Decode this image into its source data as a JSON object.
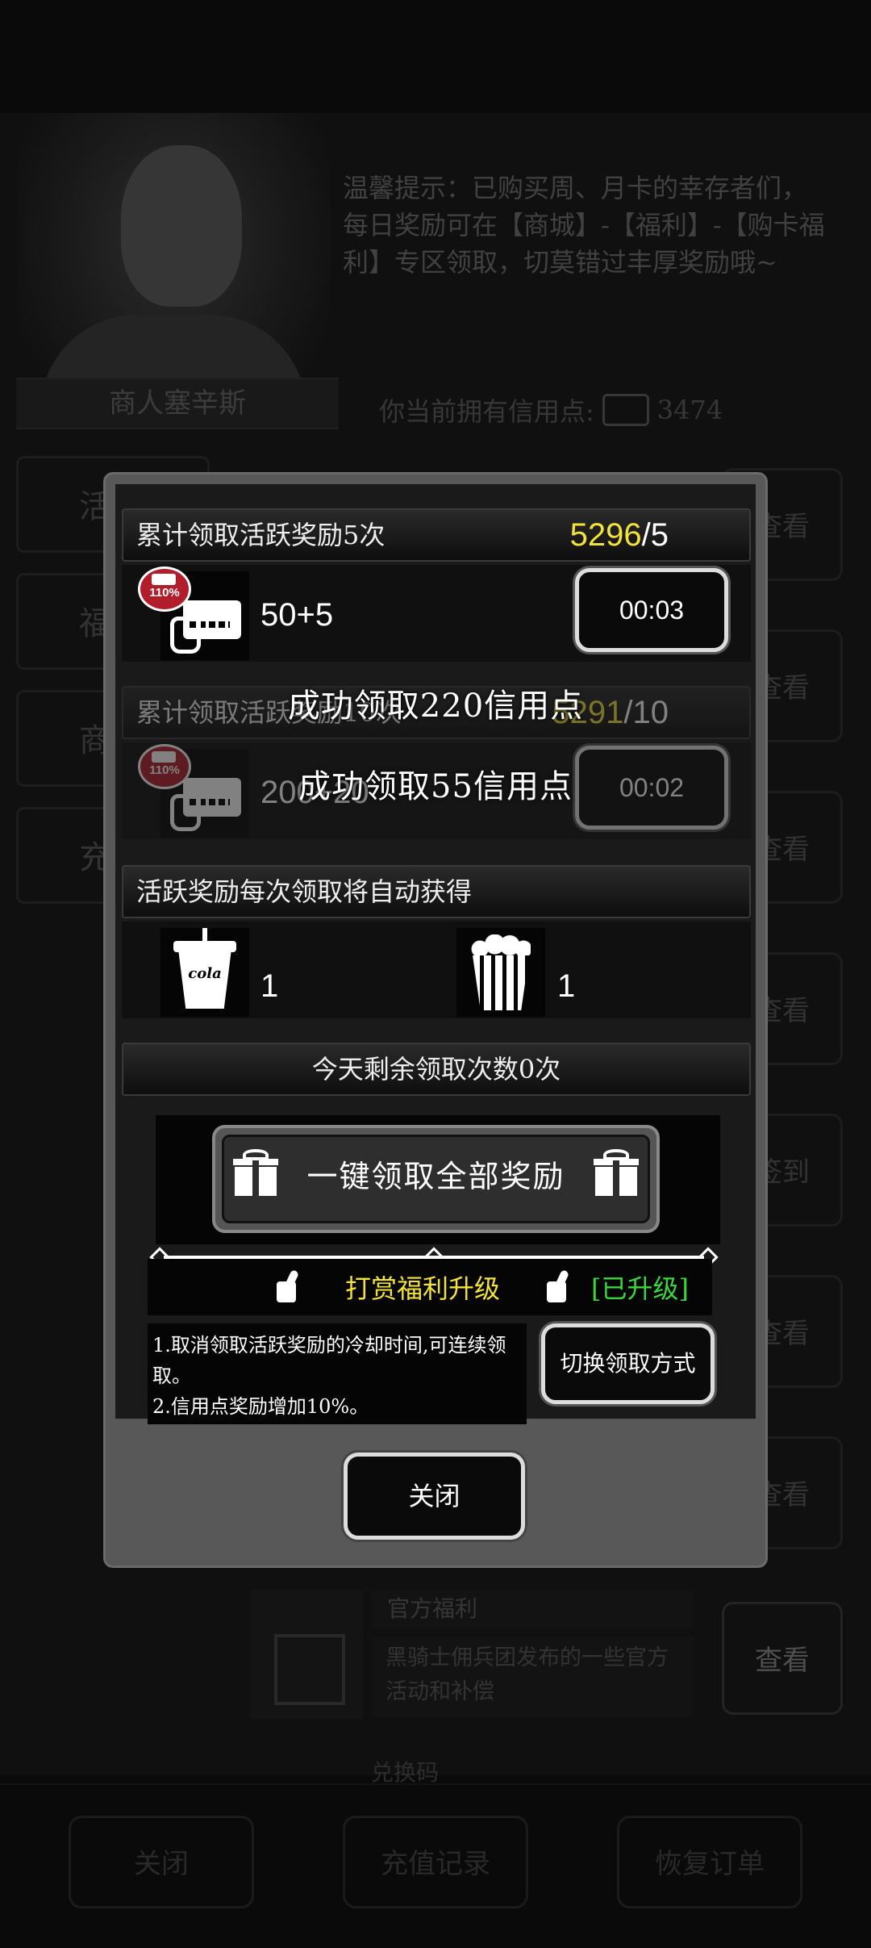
{
  "background": {
    "merchant_name": "商人塞辛斯",
    "tip": "温馨提示：已购买周、月卡的幸存者们，每日奖励可在【商城】-【福利】-【购卡福利】专区领取，切莫错过丰厚奖励哦~",
    "credits_label": "你当前拥有信用点:",
    "credits_value": "3474",
    "tabs": [
      "活",
      "福",
      "商",
      "充"
    ],
    "view_buttons": [
      "查看",
      "查看",
      "查看",
      "查看",
      "签到",
      "查看",
      "查看",
      "查看"
    ],
    "welfare": {
      "title": "官方福利",
      "desc": "黑骑士佣兵团发布的一些官方活动和补偿"
    },
    "redeem_label": "兑换码",
    "bottom_buttons": {
      "close": "关闭",
      "recharge": "充值记录",
      "restore": "恢复订单"
    }
  },
  "modal": {
    "reward1": {
      "title": "累计领取活跃奖励5次",
      "progress_current": "5296",
      "progress_target": "/5",
      "badge": "110%",
      "amount": "50+5",
      "timer": "00:03"
    },
    "reward2": {
      "title": "累计领取活跃奖励10次",
      "progress_current": "5291",
      "progress_target": "/10",
      "badge": "110%",
      "amount": "200+20",
      "timer": "00:02"
    },
    "toasts": [
      "成功领取220信用点",
      "成功领取55信用点"
    ],
    "auto_title": "活跃奖励每次领取将自动获得",
    "auto_items": [
      {
        "icon": "cola-icon",
        "label": "cola",
        "count": "1"
      },
      {
        "icon": "popcorn-icon",
        "count": "1"
      }
    ],
    "remaining": "今天剩余领取次数0次",
    "claim_all": "一键领取全部奖励",
    "upgrade_title": "打赏福利升级",
    "upgrade_status": "[已升级]",
    "benefits": [
      "1.取消领取活跃奖励的冷却时间,可连续领取。",
      "2.信用点奖励增加10%。"
    ],
    "switch_label": "切换领取方式",
    "close_label": "关闭"
  },
  "colors": {
    "highlight_yellow": "#f2e23a",
    "upgraded_green": "#3ad63a",
    "badge_red": "#b11d2a"
  }
}
